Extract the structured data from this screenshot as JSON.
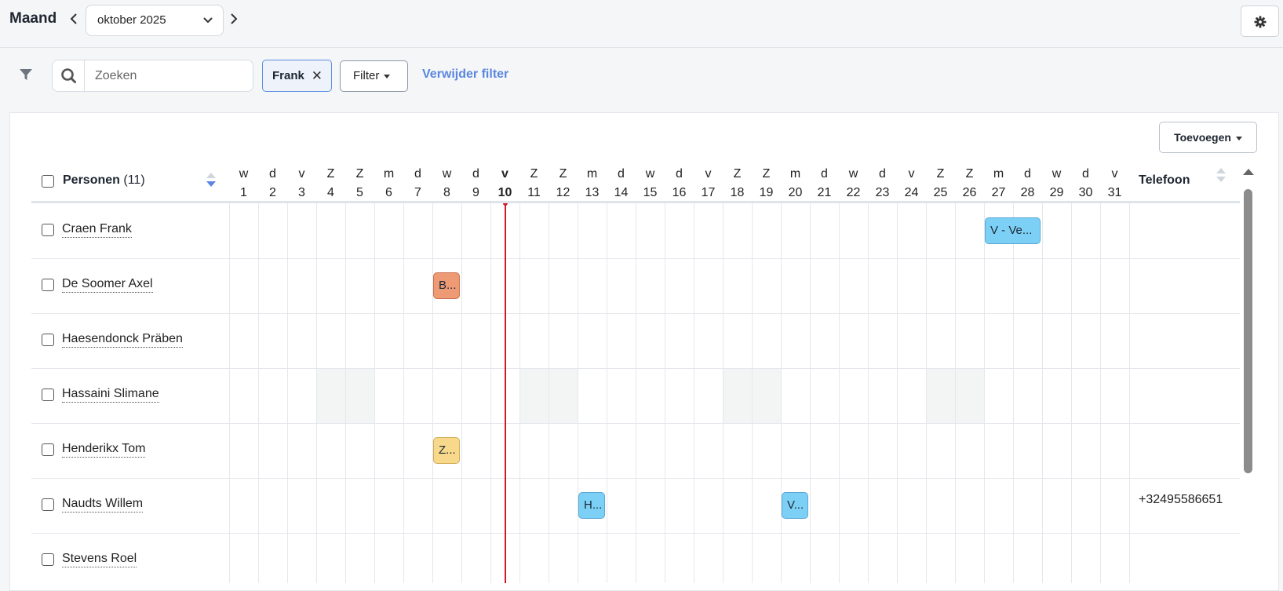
{
  "toolbar": {
    "view_label": "Maand",
    "month_value": "oktober 2025",
    "settings_icon": "gear-icon"
  },
  "filterbar": {
    "filter_icon": "funnel-icon",
    "search_placeholder": "Zoeken",
    "search_value": "",
    "chip_label": "Frank",
    "filter_button_label": "Filter",
    "remove_filter_label": "Verwijder filter"
  },
  "panel": {
    "add_button_label": "Toevoegen"
  },
  "table": {
    "persons_label": "Personen",
    "persons_count": "(11)",
    "phone_label": "Telefoon",
    "today": 10,
    "days": [
      {
        "wd": "w",
        "d": "1"
      },
      {
        "wd": "d",
        "d": "2"
      },
      {
        "wd": "v",
        "d": "3"
      },
      {
        "wd": "Z",
        "d": "4"
      },
      {
        "wd": "Z",
        "d": "5"
      },
      {
        "wd": "m",
        "d": "6"
      },
      {
        "wd": "d",
        "d": "7"
      },
      {
        "wd": "w",
        "d": "8"
      },
      {
        "wd": "d",
        "d": "9"
      },
      {
        "wd": "v",
        "d": "10"
      },
      {
        "wd": "Z",
        "d": "11"
      },
      {
        "wd": "Z",
        "d": "12"
      },
      {
        "wd": "m",
        "d": "13"
      },
      {
        "wd": "d",
        "d": "14"
      },
      {
        "wd": "w",
        "d": "15"
      },
      {
        "wd": "d",
        "d": "16"
      },
      {
        "wd": "v",
        "d": "17"
      },
      {
        "wd": "Z",
        "d": "18"
      },
      {
        "wd": "Z",
        "d": "19"
      },
      {
        "wd": "m",
        "d": "20"
      },
      {
        "wd": "d",
        "d": "21"
      },
      {
        "wd": "w",
        "d": "22"
      },
      {
        "wd": "d",
        "d": "23"
      },
      {
        "wd": "v",
        "d": "24"
      },
      {
        "wd": "Z",
        "d": "25"
      },
      {
        "wd": "Z",
        "d": "26"
      },
      {
        "wd": "m",
        "d": "27"
      },
      {
        "wd": "d",
        "d": "28"
      },
      {
        "wd": "w",
        "d": "29"
      },
      {
        "wd": "d",
        "d": "30"
      },
      {
        "wd": "v",
        "d": "31"
      }
    ],
    "persons": [
      {
        "name": "Craen Frank",
        "phone": "",
        "weekend_shaded": false,
        "events": [
          {
            "label": "V - Ve...",
            "start": 27,
            "end": 28,
            "color": "#7dd0f5",
            "border": "#5aa7d4"
          }
        ]
      },
      {
        "name": "De Soomer Axel",
        "phone": "",
        "weekend_shaded": false,
        "events": [
          {
            "label": "B...",
            "start": 8,
            "end": 8,
            "color": "#ee9a74",
            "border": "#c9714c"
          }
        ]
      },
      {
        "name": "Haesendonck Präben",
        "phone": "",
        "weekend_shaded": false,
        "events": []
      },
      {
        "name": "Hassaini Slimane",
        "phone": "",
        "weekend_shaded": true,
        "events": []
      },
      {
        "name": "Henderikx Tom",
        "phone": "",
        "weekend_shaded": false,
        "events": [
          {
            "label": "Z...",
            "start": 8,
            "end": 8,
            "color": "#f8d98c",
            "border": "#d2ac55"
          }
        ]
      },
      {
        "name": "Naudts Willem",
        "phone": "+32495586651",
        "weekend_shaded": false,
        "events": [
          {
            "label": "H...",
            "start": 13,
            "end": 13,
            "color": "#7dd0f5",
            "border": "#5aa7d4"
          },
          {
            "label": "V...",
            "start": 20,
            "end": 20,
            "color": "#7dd0f5",
            "border": "#5aa7d4"
          }
        ]
      },
      {
        "name": "Stevens Roel",
        "phone": "",
        "weekend_shaded": false,
        "events": []
      }
    ]
  }
}
